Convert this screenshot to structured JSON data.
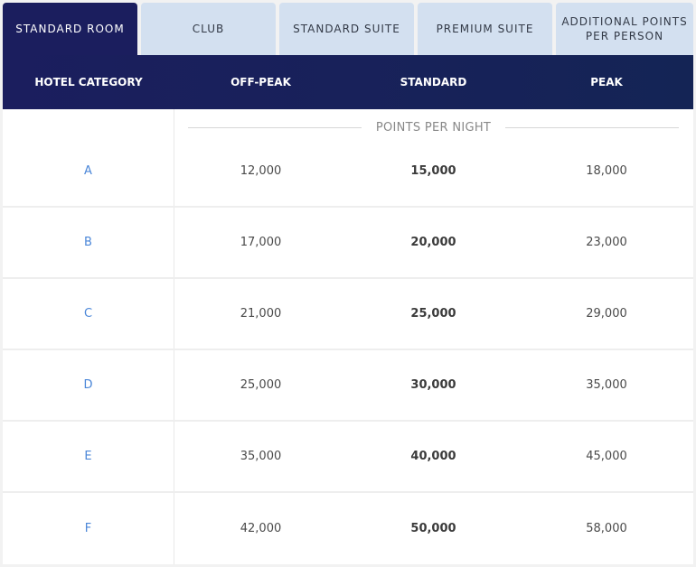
{
  "tabs": [
    {
      "label": "STANDARD ROOM",
      "active": true
    },
    {
      "label": "CLUB",
      "active": false
    },
    {
      "label": "STANDARD SUITE",
      "active": false
    },
    {
      "label": "PREMIUM SUITE",
      "active": false
    },
    {
      "label": "ADDITIONAL POINTS PER PERSON",
      "active": false
    }
  ],
  "table": {
    "headers": [
      "HOTEL CATEGORY",
      "OFF-PEAK",
      "STANDARD",
      "PEAK"
    ],
    "subheader": "POINTS PER NIGHT",
    "rows": [
      {
        "category": "A",
        "off_peak": "12,000",
        "standard": "15,000",
        "peak": "18,000"
      },
      {
        "category": "B",
        "off_peak": "17,000",
        "standard": "20,000",
        "peak": "23,000"
      },
      {
        "category": "C",
        "off_peak": "21,000",
        "standard": "25,000",
        "peak": "29,000"
      },
      {
        "category": "D",
        "off_peak": "25,000",
        "standard": "30,000",
        "peak": "35,000"
      },
      {
        "category": "E",
        "off_peak": "35,000",
        "standard": "40,000",
        "peak": "45,000"
      },
      {
        "category": "F",
        "off_peak": "42,000",
        "standard": "50,000",
        "peak": "58,000"
      }
    ]
  },
  "colors": {
    "active_tab": "#1b1e5e",
    "inactive_tab": "#d3e0f0",
    "category_link": "#4a86d8"
  }
}
